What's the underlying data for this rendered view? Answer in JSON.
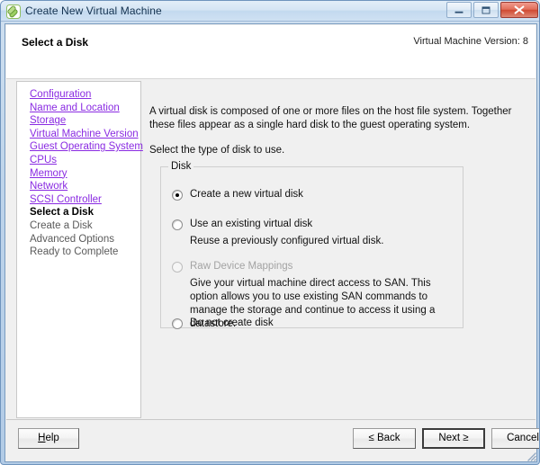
{
  "window": {
    "title": "Create New Virtual Machine",
    "app_icon": "vmware-vm-icon",
    "controls": {
      "minimize": "minimize-button",
      "maximize": "maximize-button",
      "close": "close-button"
    }
  },
  "header": {
    "page_title": "Select a Disk",
    "version_label": "Virtual Machine Version: 8"
  },
  "sidebar": {
    "items": [
      {
        "label": "Configuration",
        "state": "link"
      },
      {
        "label": "Name and Location",
        "state": "link"
      },
      {
        "label": "Storage",
        "state": "link"
      },
      {
        "label": "Virtual Machine Version",
        "state": "link"
      },
      {
        "label": "Guest Operating System",
        "state": "link"
      },
      {
        "label": "CPUs",
        "state": "link"
      },
      {
        "label": "Memory",
        "state": "link"
      },
      {
        "label": "Network",
        "state": "link"
      },
      {
        "label": "SCSI Controller",
        "state": "link"
      },
      {
        "label": "Select a Disk",
        "state": "current"
      },
      {
        "label": "Create a Disk",
        "state": "future"
      },
      {
        "label": "Advanced Options",
        "state": "future"
      },
      {
        "label": "Ready to Complete",
        "state": "future"
      }
    ]
  },
  "main": {
    "intro_paragraph": "A virtual disk is composed of one or more files on the host file system. Together these files appear as a single hard disk to the guest operating system.",
    "instruction": "Select the type of disk to use.",
    "group": {
      "legend": "Disk",
      "options": [
        {
          "label": "Create a new virtual disk",
          "selected": true,
          "enabled": true,
          "description": ""
        },
        {
          "label": "Use an existing virtual disk",
          "selected": false,
          "enabled": true,
          "description": "Reuse a previously configured virtual disk."
        },
        {
          "label": "Raw Device Mappings",
          "selected": false,
          "enabled": false,
          "description": "Give your virtual machine direct access to SAN. This option allows you to use existing SAN commands to manage the storage and continue to access it using a datastore."
        },
        {
          "label": "Do not create disk",
          "selected": false,
          "enabled": true,
          "description": ""
        }
      ]
    }
  },
  "footer": {
    "help_label": "Help",
    "help_accel": "H",
    "back_label": "≤ Back",
    "next_label": "Next ≥",
    "cancel_label": "Cancel"
  },
  "colors": {
    "link": "#8a2be2",
    "title_text": "#12314f",
    "close_button": "#cf4a33",
    "dialog_face": "#f0f0f0"
  }
}
